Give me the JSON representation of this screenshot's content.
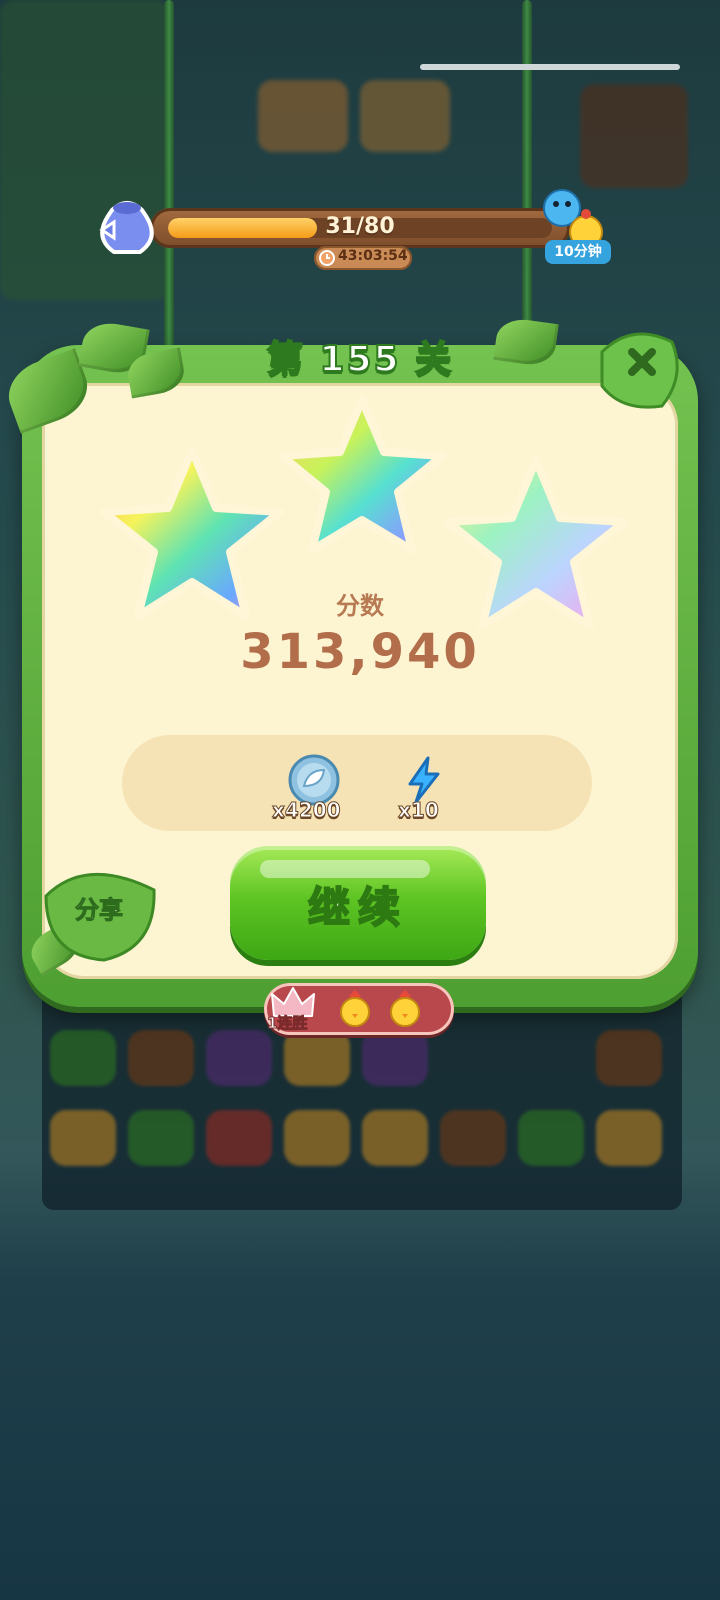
{
  "progress": {
    "text": "31/80",
    "current": 31,
    "total": 80
  },
  "timer": {
    "text": "43:03:54"
  },
  "reward_badge": {
    "text": "10分钟"
  },
  "level": {
    "title": "第 155 关"
  },
  "stars": {
    "earned": 3,
    "total": 3
  },
  "score": {
    "label": "分数",
    "value": "313,940"
  },
  "rewards": {
    "coins": "x4200",
    "energy": "x10"
  },
  "buttons": {
    "continue": "继续",
    "share": "分享"
  },
  "streak": {
    "label": "1连胜"
  },
  "icons": [
    "bag-icon",
    "clock-icon",
    "blue-bear-icon",
    "chick-icon",
    "close-icon",
    "star-icon",
    "coin-leaf-icon",
    "lightning-icon",
    "crown-icon"
  ],
  "colors": {
    "panel_green": "#5fb03a",
    "panel_cream": "#fdf4d2",
    "score_brown": "#b26d4a",
    "button_green": "#5fc524",
    "progress_orange": "#f59b19"
  }
}
